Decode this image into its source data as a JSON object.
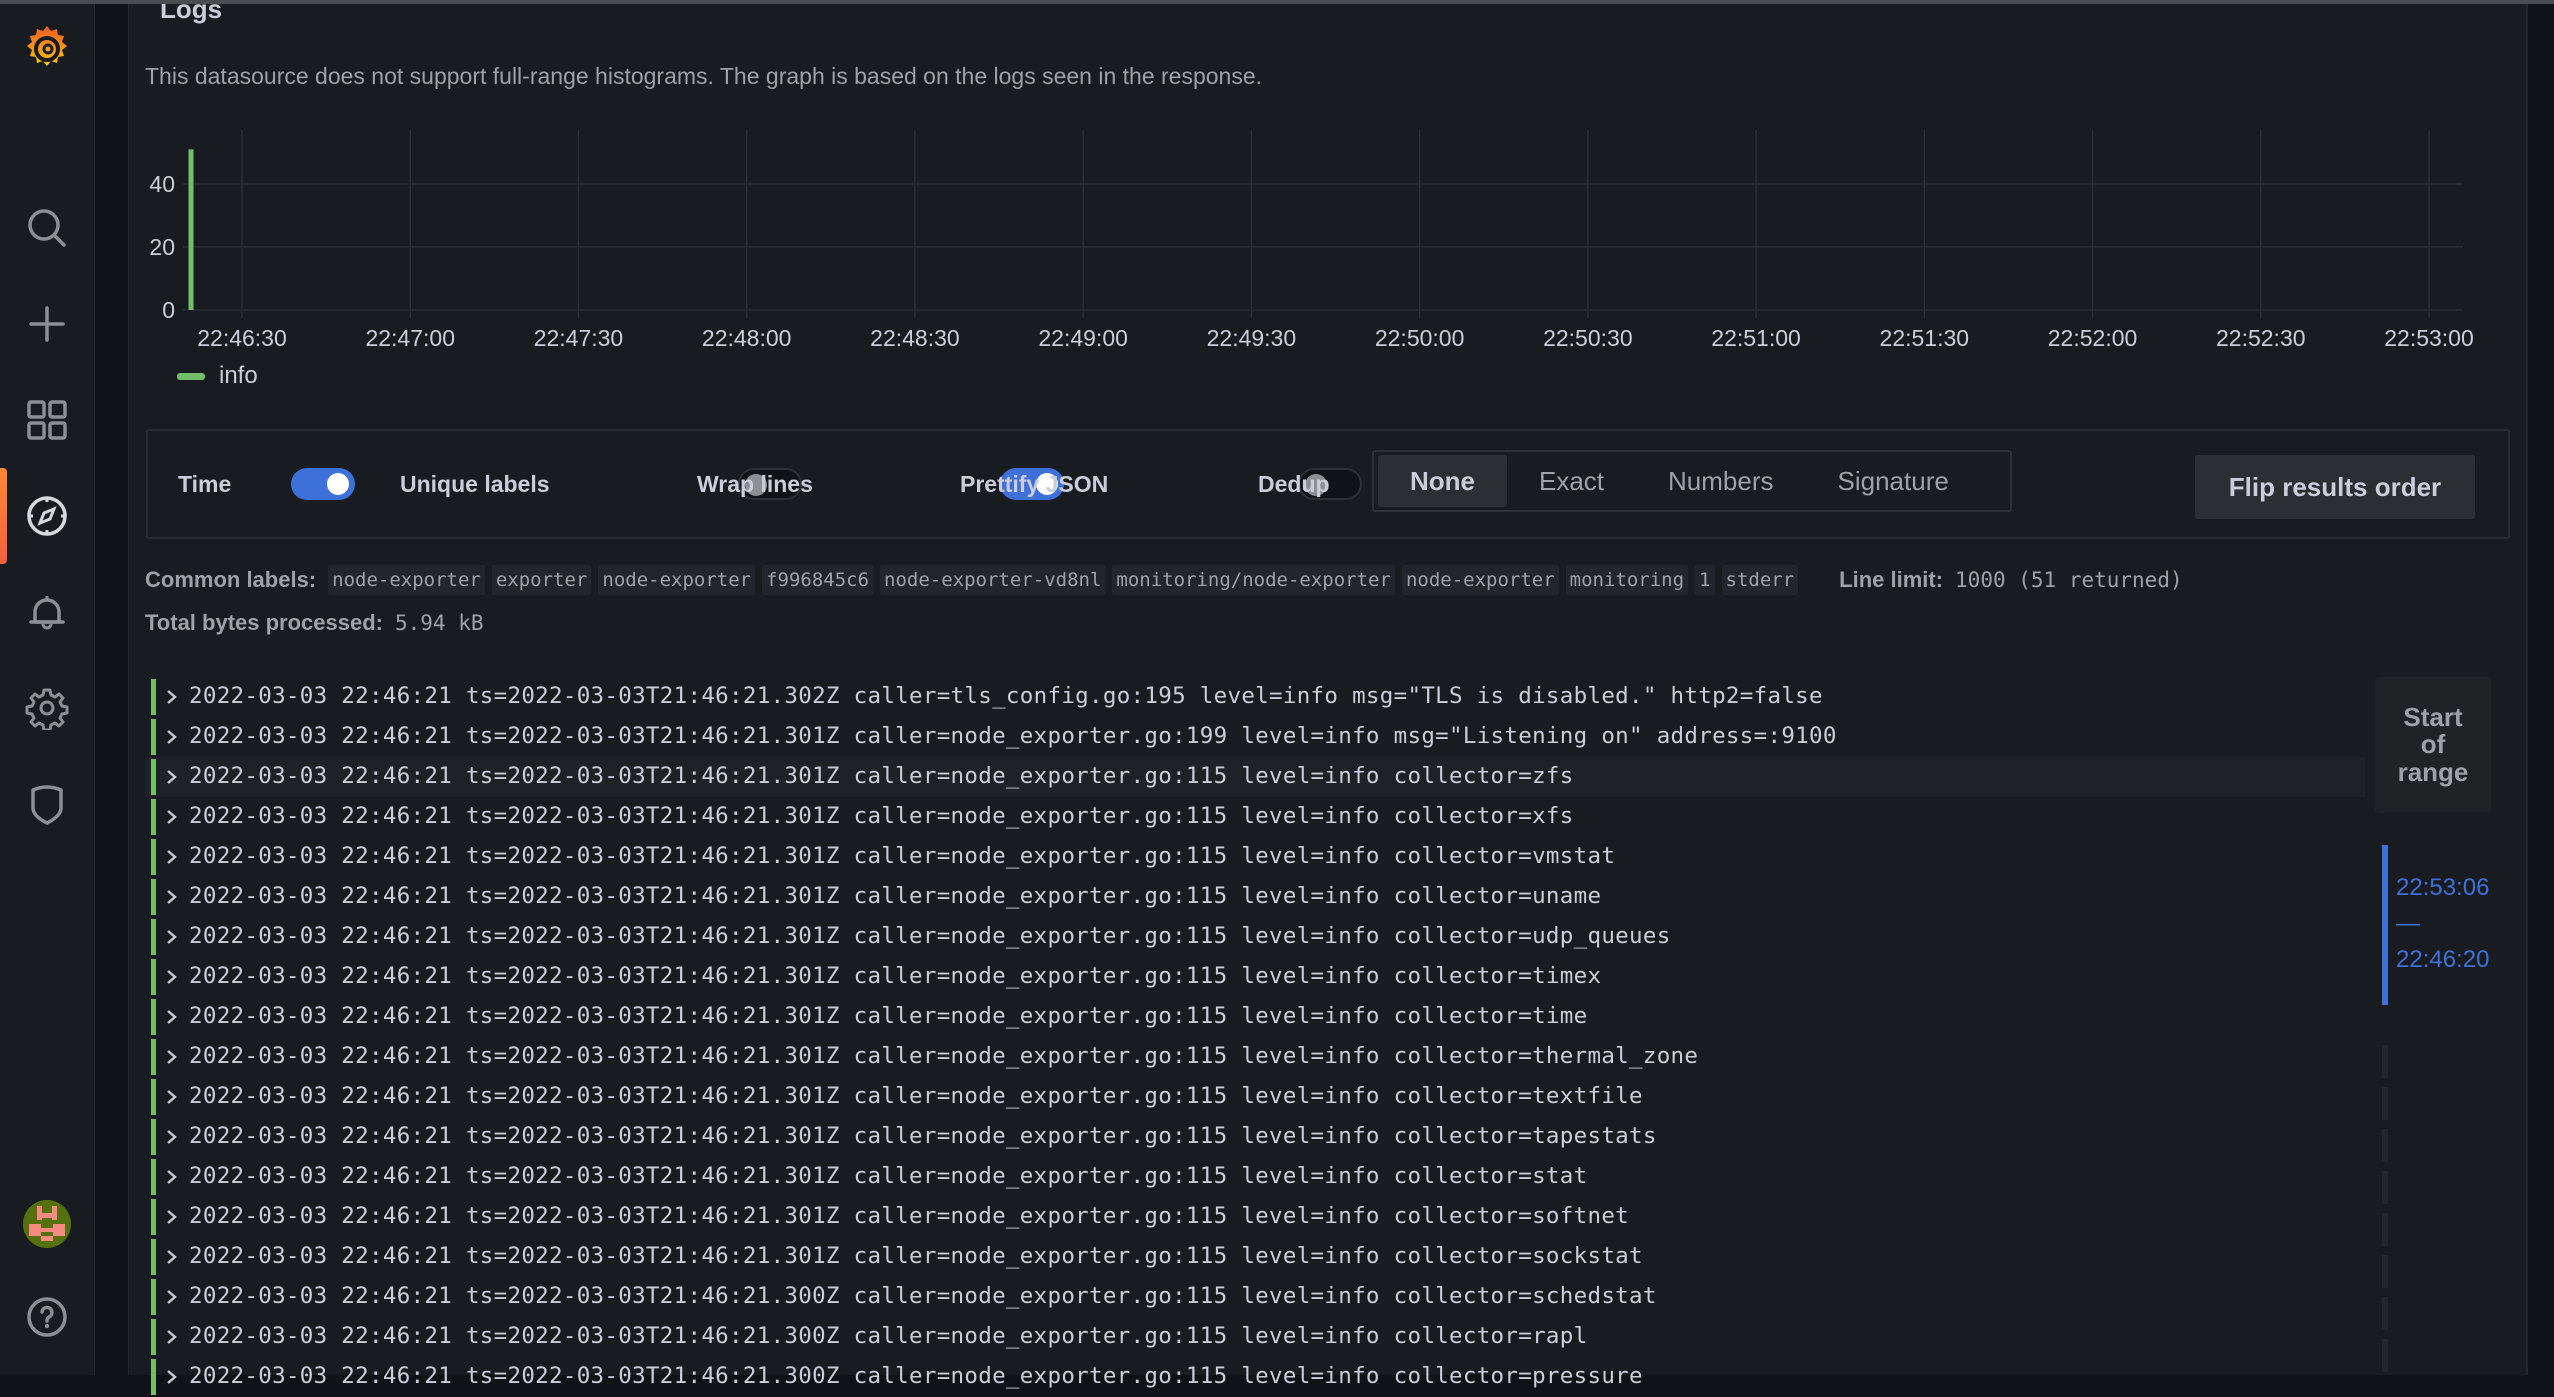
{
  "sidebar": {
    "logo": "grafana-logo",
    "items": [
      {
        "name": "search",
        "icon": "search-icon"
      },
      {
        "name": "create",
        "icon": "plus-icon"
      },
      {
        "name": "dashboards",
        "icon": "dashboards-grid-icon"
      },
      {
        "name": "explore",
        "icon": "compass-icon",
        "active": true
      },
      {
        "name": "alerting",
        "icon": "bell-icon"
      },
      {
        "name": "configuration",
        "icon": "gear-icon"
      },
      {
        "name": "server-admin",
        "icon": "shield-icon"
      }
    ],
    "profile": "avatar",
    "help": "help-icon"
  },
  "panel": {
    "title": "Logs",
    "info": "This datasource does not support full-range histograms. The graph is based on the logs seen in the response."
  },
  "chart_data": {
    "type": "bar",
    "title": "",
    "xlabel": "",
    "ylabel": "",
    "x_ticks": [
      "22:46:30",
      "22:47:00",
      "22:47:30",
      "22:48:00",
      "22:48:30",
      "22:49:00",
      "22:49:30",
      "22:50:00",
      "22:50:30",
      "22:51:00",
      "22:51:30",
      "22:52:00",
      "22:52:30",
      "22:53:00"
    ],
    "y_ticks": [
      0,
      20,
      40
    ],
    "ylim": [
      0,
      55
    ],
    "xlim": [
      "22:46:17",
      "22:53:06"
    ],
    "grid": true,
    "legend_position": "bottom-left",
    "series": [
      {
        "name": "info",
        "color": "#73bf69",
        "points": [
          {
            "x": "22:46:21",
            "y": 51
          }
        ]
      }
    ]
  },
  "controls": {
    "time": {
      "label": "Time",
      "on": true
    },
    "unique_labels": {
      "label": "Unique labels",
      "on": false
    },
    "wrap_lines": {
      "label": "Wrap lines",
      "on": true
    },
    "prettify_json": {
      "label": "Prettify JSON",
      "on": false
    },
    "dedup": {
      "label": "Dedup",
      "options": [
        "None",
        "Exact",
        "Numbers",
        "Signature"
      ],
      "selected": "None"
    },
    "flip_label": "Flip results order"
  },
  "meta": {
    "common_labels_label": "Common labels:",
    "common_labels": [
      "node-exporter",
      "exporter",
      "node-exporter",
      "f996845c6",
      "node-exporter-vd8nl",
      "monitoring/node-exporter",
      "node-exporter",
      "monitoring",
      "1",
      "stderr"
    ],
    "line_limit_label": "Line limit:",
    "line_limit_value": "1000 (51 returned)",
    "bytes_label": "Total bytes processed:",
    "bytes_value": "5.94 kB"
  },
  "logs": [
    {
      "time": "2022-03-03 22:46:21",
      "line": "ts=2022-03-03T21:46:21.302Z caller=tls_config.go:195 level=info msg=\"TLS is disabled.\" http2=false"
    },
    {
      "time": "2022-03-03 22:46:21",
      "line": "ts=2022-03-03T21:46:21.301Z caller=node_exporter.go:199 level=info msg=\"Listening on\" address=:9100"
    },
    {
      "time": "2022-03-03 22:46:21",
      "line": "ts=2022-03-03T21:46:21.301Z caller=node_exporter.go:115 level=info collector=zfs",
      "hover": true
    },
    {
      "time": "2022-03-03 22:46:21",
      "line": "ts=2022-03-03T21:46:21.301Z caller=node_exporter.go:115 level=info collector=xfs"
    },
    {
      "time": "2022-03-03 22:46:21",
      "line": "ts=2022-03-03T21:46:21.301Z caller=node_exporter.go:115 level=info collector=vmstat"
    },
    {
      "time": "2022-03-03 22:46:21",
      "line": "ts=2022-03-03T21:46:21.301Z caller=node_exporter.go:115 level=info collector=uname"
    },
    {
      "time": "2022-03-03 22:46:21",
      "line": "ts=2022-03-03T21:46:21.301Z caller=node_exporter.go:115 level=info collector=udp_queues"
    },
    {
      "time": "2022-03-03 22:46:21",
      "line": "ts=2022-03-03T21:46:21.301Z caller=node_exporter.go:115 level=info collector=timex"
    },
    {
      "time": "2022-03-03 22:46:21",
      "line": "ts=2022-03-03T21:46:21.301Z caller=node_exporter.go:115 level=info collector=time"
    },
    {
      "time": "2022-03-03 22:46:21",
      "line": "ts=2022-03-03T21:46:21.301Z caller=node_exporter.go:115 level=info collector=thermal_zone"
    },
    {
      "time": "2022-03-03 22:46:21",
      "line": "ts=2022-03-03T21:46:21.301Z caller=node_exporter.go:115 level=info collector=textfile"
    },
    {
      "time": "2022-03-03 22:46:21",
      "line": "ts=2022-03-03T21:46:21.301Z caller=node_exporter.go:115 level=info collector=tapestats"
    },
    {
      "time": "2022-03-03 22:46:21",
      "line": "ts=2022-03-03T21:46:21.301Z caller=node_exporter.go:115 level=info collector=stat"
    },
    {
      "time": "2022-03-03 22:46:21",
      "line": "ts=2022-03-03T21:46:21.301Z caller=node_exporter.go:115 level=info collector=softnet"
    },
    {
      "time": "2022-03-03 22:46:21",
      "line": "ts=2022-03-03T21:46:21.301Z caller=node_exporter.go:115 level=info collector=sockstat"
    },
    {
      "time": "2022-03-03 22:46:21",
      "line": "ts=2022-03-03T21:46:21.300Z caller=node_exporter.go:115 level=info collector=schedstat"
    },
    {
      "time": "2022-03-03 22:46:21",
      "line": "ts=2022-03-03T21:46:21.300Z caller=node_exporter.go:115 level=info collector=rapl"
    },
    {
      "time": "2022-03-03 22:46:21",
      "line": "ts=2022-03-03T21:46:21.300Z caller=node_exporter.go:115 level=info collector=pressure"
    }
  ],
  "range_nav": {
    "start_label": "Start of range",
    "from": "22:53:06",
    "separator": "—",
    "to": "22:46:20"
  },
  "colors": {
    "accent": "#3d71d9",
    "info_level": "#73bf69",
    "active_nav": "#f55f3e"
  }
}
